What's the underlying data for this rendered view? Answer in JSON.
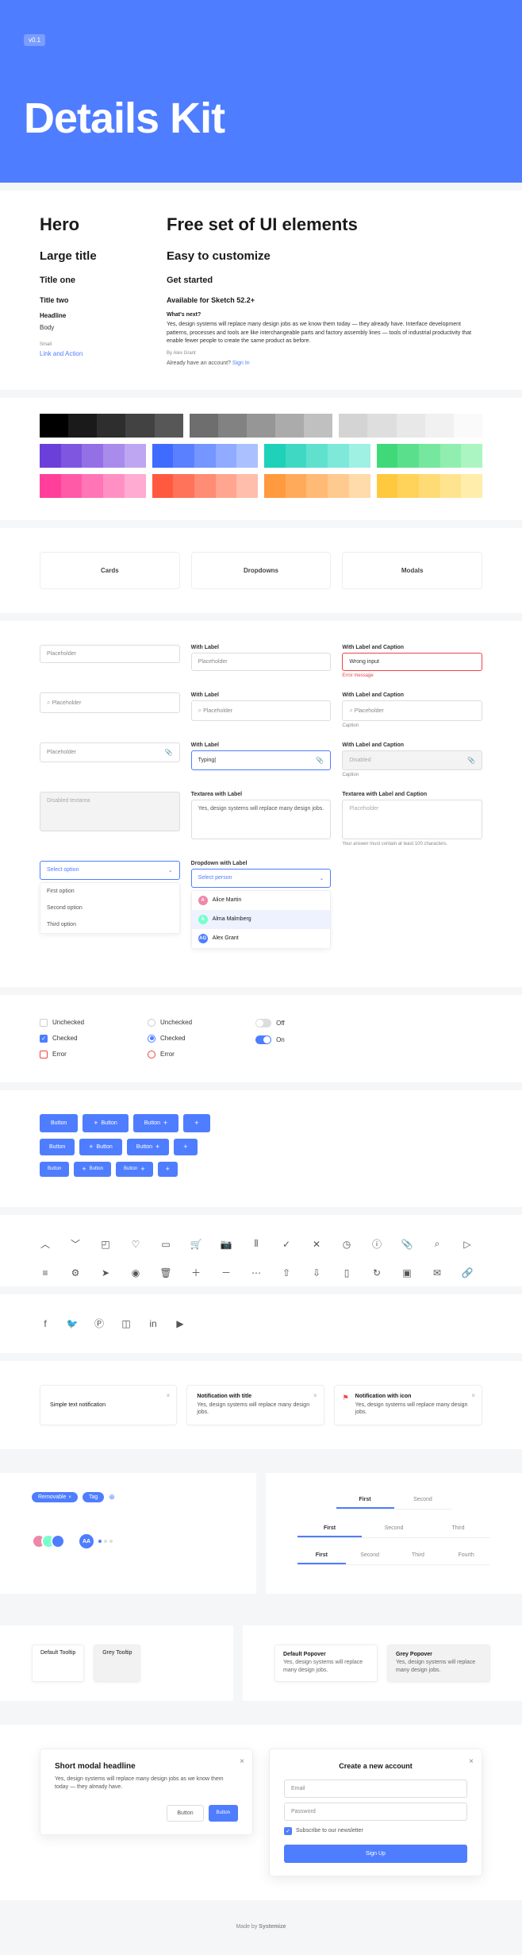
{
  "hero": {
    "version": "v0.1",
    "title": "Details Kit"
  },
  "typography": {
    "left": {
      "hero": "Hero",
      "large": "Large title",
      "one": "Title one",
      "two": "Title two",
      "head": "Headline",
      "body": "Body",
      "small": "Small",
      "link": "Link and Action"
    },
    "right": {
      "hero": "Free set of UI elements",
      "large": "Easy to customize",
      "one": "Get started",
      "two": "Available for Sketch 52.2+",
      "head": "What's next?",
      "body": "Yes, design systems will replace many design jobs as we know them today — they already have. Interface development patterns, processes and tools are like interchangeable parts and factory assembly lines — tools of industrial productivity that enable fewer people to create the same product as before.",
      "by": "By Alex Grant",
      "acc_text": "Already have an account?",
      "acc_link": "Sign In"
    }
  },
  "palette": {
    "row1": [
      [
        "#000000",
        "#1a1a1a",
        "#2e2e2e",
        "#424242",
        "#575757"
      ],
      [
        "#6e6e6e",
        "#828282",
        "#969696",
        "#ababab",
        "#c0c0c0"
      ],
      [
        "#d4d4d4",
        "#dedede",
        "#e8e8e8",
        "#f1f1f1",
        "#fafafa"
      ]
    ],
    "row2": [
      [
        "#6b3fd9",
        "#7f56e0",
        "#9470e6",
        "#a98bec",
        "#bea6f2"
      ],
      [
        "#3f6bff",
        "#5a80ff",
        "#7596ff",
        "#90abff",
        "#abc1ff"
      ],
      [
        "#1fd1b8",
        "#3fd9c3",
        "#5fe1ce",
        "#7fe9d9",
        "#9ff1e4"
      ],
      [
        "#3fd97a",
        "#5ae08c",
        "#75e79e",
        "#90eeb0",
        "#abf5c2"
      ]
    ],
    "row3": [
      [
        "#ff3f9a",
        "#ff5aa8",
        "#ff75b6",
        "#ff90c4",
        "#ffabd2"
      ],
      [
        "#ff5a3f",
        "#ff735a",
        "#ff8c75",
        "#ffa590",
        "#ffbeab"
      ],
      [
        "#ff9a3f",
        "#ffaa5a",
        "#ffba75",
        "#ffca90",
        "#ffdaab"
      ],
      [
        "#ffc93f",
        "#ffd25a",
        "#ffdb75",
        "#ffe490",
        "#ffedab"
      ]
    ]
  },
  "tabs": [
    "Cards",
    "Dropdowns",
    "Modals"
  ],
  "forms": {
    "placeholder": "Placeholder",
    "with_label": "With Label",
    "with_label_caption": "With Label and Caption",
    "wrong": "Wrong input",
    "err_msg": "Error message",
    "caption": "Caption",
    "typing": "Typing|",
    "disabled": "Disabled",
    "disabled_ta": "Disabled textarea",
    "ta_label": "Textarea with Label",
    "ta_caption_label": "Textarea with Label and Caption",
    "ta_text": "Yes, design systems will replace many design jobs.",
    "ta_ph": "Placeholder",
    "ta_caption": "Your answer must contain at least 100 characters.",
    "dd_label": "Dropdown with Label",
    "select_option": "Select option",
    "select_person": "Select person",
    "opts": [
      "First option",
      "Second option",
      "Third option"
    ],
    "people": [
      "Alice Martin",
      "Alma Malmberg",
      "Alex Grant"
    ]
  },
  "checks": {
    "unchecked": "Unchecked",
    "checked": "Checked",
    "error": "Error",
    "off": "Off",
    "on": "On"
  },
  "buttons": {
    "label": "Button"
  },
  "icons": [
    "chevron-up",
    "chevron-down",
    "bookmark",
    "heart",
    "briefcase",
    "cart",
    "camera",
    "chart",
    "check",
    "close",
    "clock",
    "info",
    "attachment",
    "search",
    "play",
    "menu",
    "settings",
    "send",
    "user",
    "trash",
    "plus",
    "minus",
    "more",
    "upload",
    "download",
    "file",
    "refresh",
    "image",
    "mail",
    "link"
  ],
  "social": [
    "facebook",
    "twitter",
    "pinterest",
    "instagram",
    "linkedin",
    "youtube"
  ],
  "notifs": {
    "simple": "Simple text notification",
    "title": "Notification with title",
    "icon": "Notification with icon",
    "body": "Yes, design systems will replace many design jobs."
  },
  "tags": [
    "Removable",
    "Tag"
  ],
  "tabsets": {
    "two": [
      "First",
      "Second"
    ],
    "three": [
      "First",
      "Second",
      "Third"
    ],
    "four": [
      "First",
      "Second",
      "Third",
      "Fourth"
    ]
  },
  "avatar_initials": "AA",
  "tooltips": {
    "default": "Default Tooltip",
    "grey": "Grey Tooltip"
  },
  "popovers": {
    "default": "Default Popover",
    "grey": "Grey Popover",
    "body": "Yes, design systems will replace many design jobs."
  },
  "modal": {
    "title": "Short modal headline",
    "body": "Yes, design systems will replace many design jobs as we know them today — they already have.",
    "btn1": "Button",
    "btn2": "Button"
  },
  "signup": {
    "title": "Create a new account",
    "email": "Email",
    "password": "Password",
    "sub": "Subscribe to our newsletter",
    "btn": "Sign Up"
  },
  "footer": {
    "made": "Made by",
    "brand": "Systemize"
  }
}
